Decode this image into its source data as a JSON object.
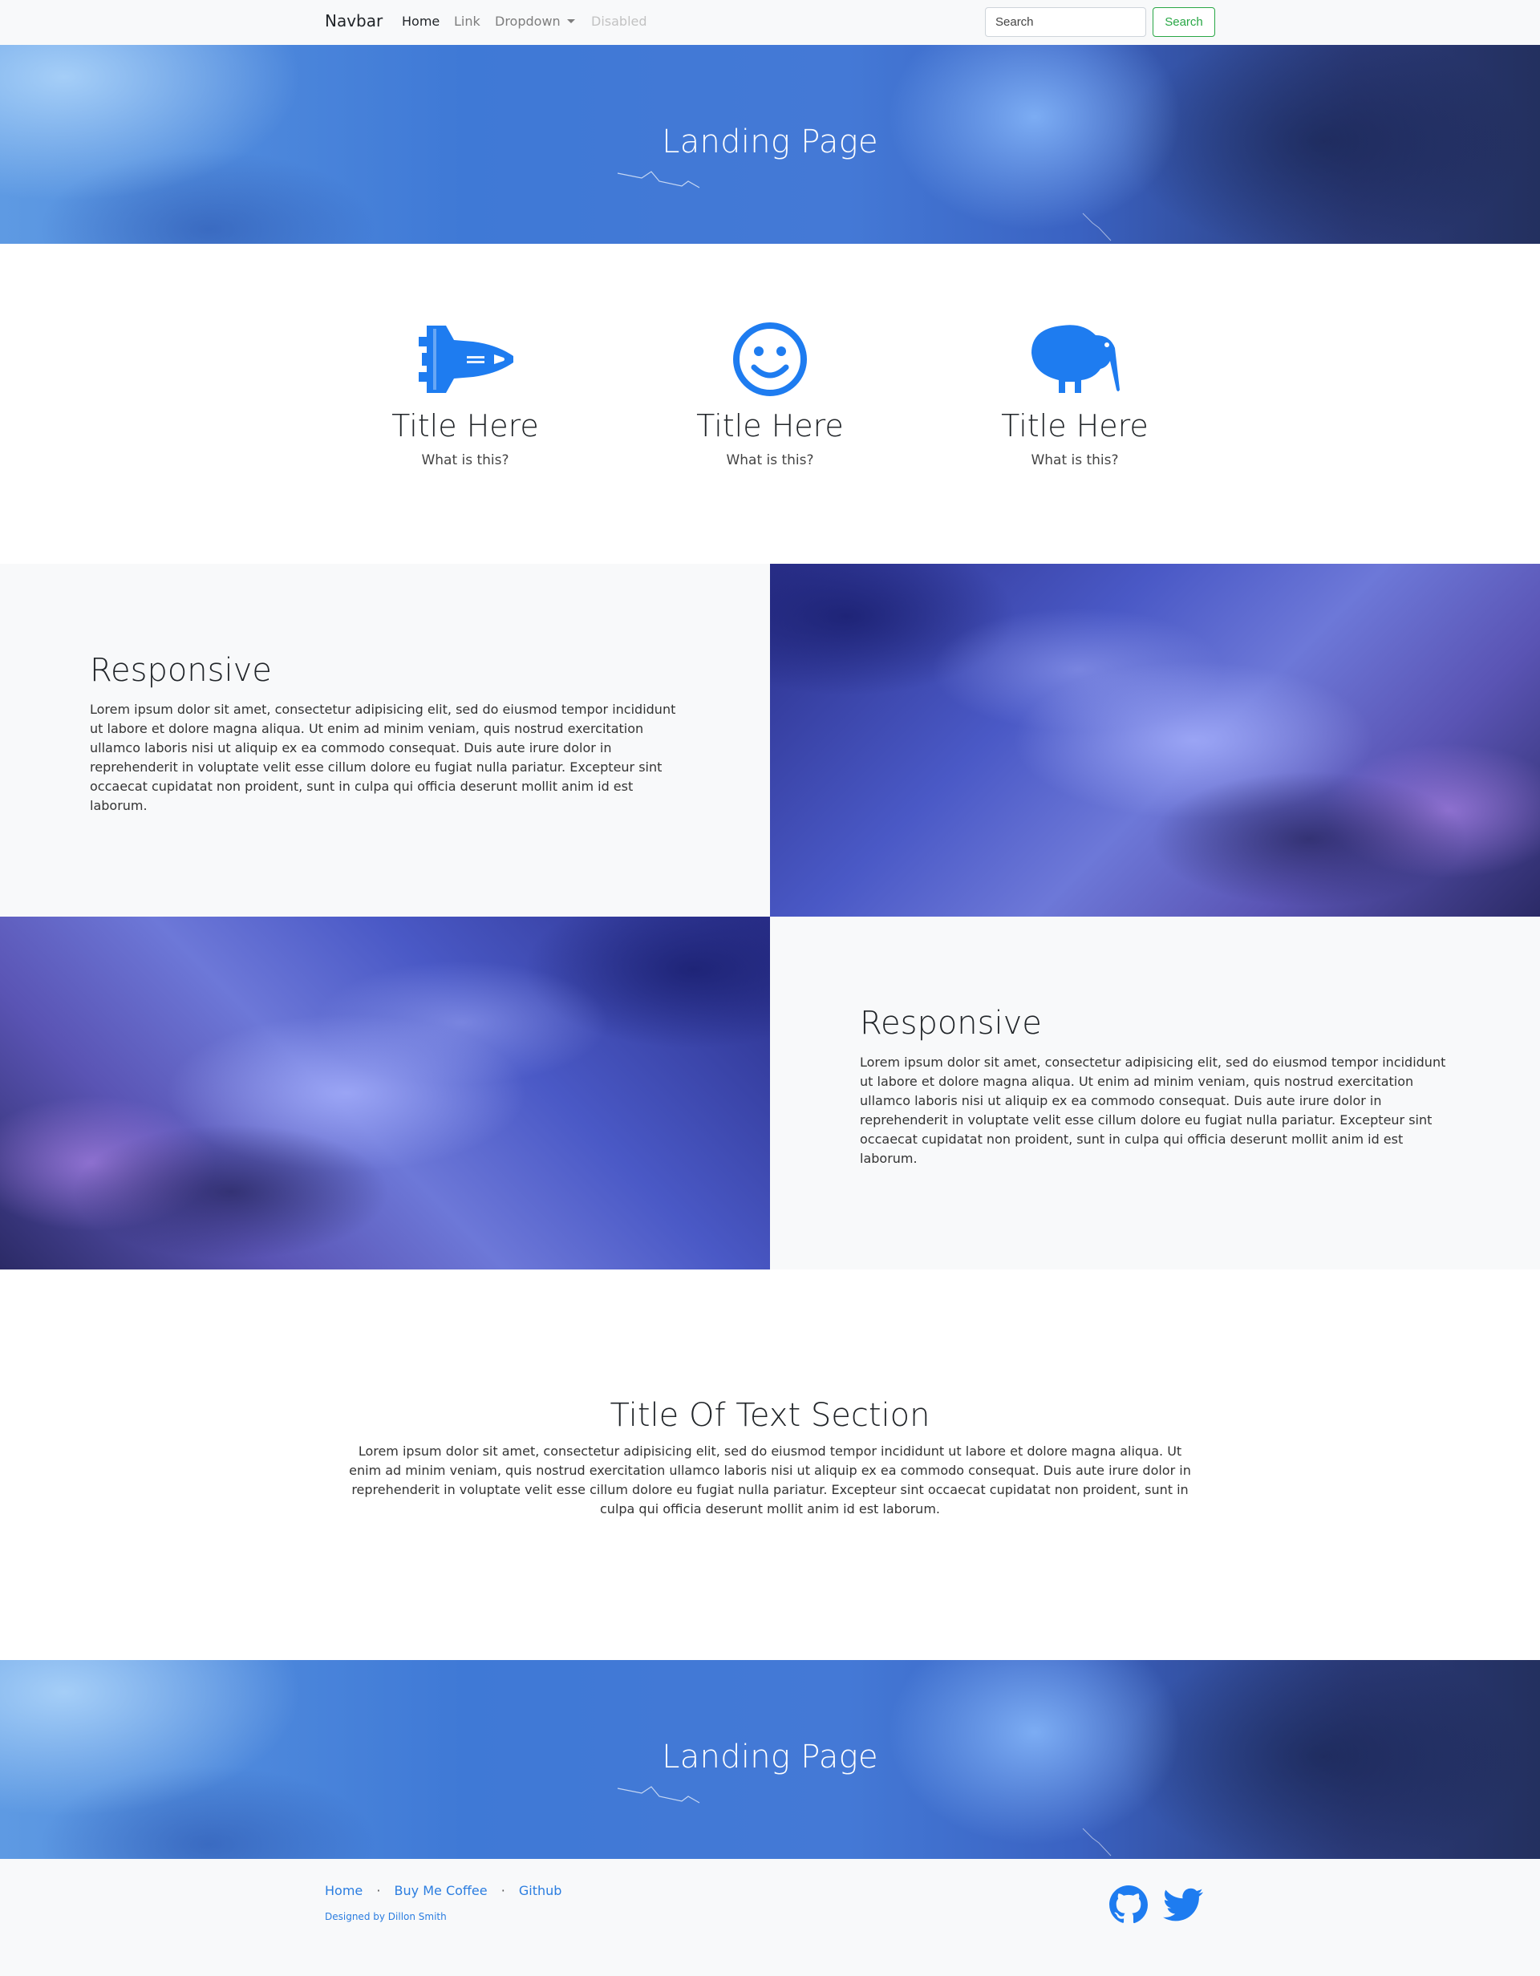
{
  "navbar": {
    "brand": "Navbar",
    "links": [
      {
        "label": "Home"
      },
      {
        "label": "Link"
      },
      {
        "label": "Dropdown"
      },
      {
        "label": "Disabled"
      }
    ],
    "search": {
      "placeholder": "Search",
      "button_label": "Search"
    }
  },
  "hero_top": {
    "title": "Landing Page"
  },
  "features": [
    {
      "icon": "space-shuttle-icon",
      "title": "Title Here",
      "text": "What is this?"
    },
    {
      "icon": "smiley-face-icon",
      "title": "Title Here",
      "text": "What is this?"
    },
    {
      "icon": "kiwi-bird-icon",
      "title": "Title Here",
      "text": "What is this?"
    }
  ],
  "splits": [
    {
      "heading": "Responsive",
      "body": "Lorem ipsum dolor sit amet, consectetur adipisicing elit, sed do eiusmod tempor incididunt ut labore et dolore magna aliqua. Ut enim ad minim veniam, quis nostrud exercitation ullamco laboris nisi ut aliquip ex ea commodo consequat. Duis aute irure dolor in reprehenderit in voluptate velit esse cillum dolore eu fugiat nulla pariatur. Excepteur sint occaecat cupidatat non proident, sunt in culpa qui officia deserunt mollit anim id est laborum."
    },
    {
      "heading": "Responsive",
      "body": "Lorem ipsum dolor sit amet, consectetur adipisicing elit, sed do eiusmod tempor incididunt ut labore et dolore magna aliqua. Ut enim ad minim veniam, quis nostrud exercitation ullamco laboris nisi ut aliquip ex ea commodo consequat. Duis aute irure dolor in reprehenderit in voluptate velit esse cillum dolore eu fugiat nulla pariatur. Excepteur sint occaecat cupidatat non proident, sunt in culpa qui officia deserunt mollit anim id est laborum."
    }
  ],
  "text_section": {
    "title": "Title Of Text Section",
    "body": "Lorem ipsum dolor sit amet, consectetur adipisicing elit, sed do eiusmod tempor incididunt ut labore et dolore magna aliqua. Ut enim ad minim veniam, quis nostrud exercitation ullamco laboris nisi ut aliquip ex ea commodo consequat. Duis aute irure dolor in reprehenderit in voluptate velit esse cillum dolore eu fugiat nulla pariatur. Excepteur sint occaecat cupidatat non proident, sunt in culpa qui officia deserunt mollit anim id est laborum."
  },
  "hero_bottom": {
    "title": "Landing Page"
  },
  "footer": {
    "links": [
      {
        "label": "Home"
      },
      {
        "label": "Buy Me Coffee"
      },
      {
        "label": "Github"
      }
    ],
    "separator": "·",
    "credit": "Designed by Dillon Smith",
    "social": [
      "github-icon",
      "twitter-icon"
    ]
  },
  "colors": {
    "accent": "#2b7de0",
    "icon_blue": "#1e7cf0",
    "success": "#28a745",
    "navbar_bg": "#f8f9fa"
  }
}
